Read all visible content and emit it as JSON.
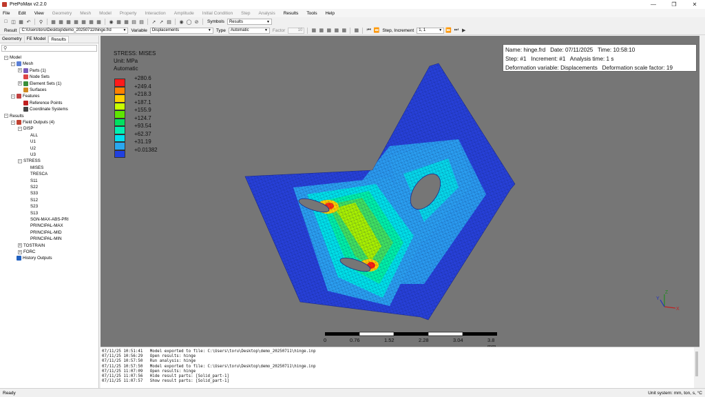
{
  "window": {
    "title": "PrePoMax v2.2.0"
  },
  "menu": {
    "items": [
      "File",
      "Edit",
      "View",
      "Geometry",
      "Mesh",
      "Model",
      "Property",
      "Interaction",
      "Amplitude",
      "Initial Condition",
      "Step",
      "Analysis",
      "Results",
      "Tools",
      "Help"
    ]
  },
  "toolbar": {
    "symbols_label": "Symbols",
    "symbols_value": "Results"
  },
  "results_bar": {
    "result_label": "Result",
    "result_file": "C:\\Users\\toru\\Desktop\\demo_20250711\\hinge.frd",
    "variable_label": "Variable",
    "variable_value": "Displacements",
    "type_label": "Type",
    "type_value": "Automatic",
    "factor_label": "Factor",
    "factor_value": "10",
    "step_label": "Step, Increment",
    "step_value": "1, 1"
  },
  "left_panel": {
    "tabs": [
      "Geometry",
      "FE Model",
      "Results"
    ],
    "active_tab": "Results",
    "tree": [
      {
        "label": "Model",
        "level": 0,
        "expander": "-",
        "icon": "none"
      },
      {
        "label": "Mesh",
        "level": 1,
        "expander": "-",
        "icon": "mesh"
      },
      {
        "label": "Parts (1)",
        "level": 2,
        "expander": "+",
        "icon": "parts"
      },
      {
        "label": "Node Sets",
        "level": 2,
        "expander": "",
        "icon": "nodes"
      },
      {
        "label": "Element Sets (1)",
        "level": 2,
        "expander": "+",
        "icon": "elements"
      },
      {
        "label": "Surfaces",
        "level": 2,
        "expander": "",
        "icon": "surfaces"
      },
      {
        "label": "Features",
        "level": 1,
        "expander": "-",
        "icon": "features"
      },
      {
        "label": "Reference Points",
        "level": 2,
        "expander": "",
        "icon": "refpoint"
      },
      {
        "label": "Coordinate Systems",
        "level": 2,
        "expander": "",
        "icon": "coords"
      },
      {
        "label": "Results",
        "level": 0,
        "expander": "-",
        "icon": "none"
      },
      {
        "label": "Field Outputs (4)",
        "level": 1,
        "expander": "-",
        "icon": "field"
      },
      {
        "label": "DISP",
        "level": 2,
        "expander": "-",
        "icon": "none"
      },
      {
        "label": "ALL",
        "level": 3,
        "expander": "",
        "icon": "none"
      },
      {
        "label": "U1",
        "level": 3,
        "expander": "",
        "icon": "none"
      },
      {
        "label": "U2",
        "level": 3,
        "expander": "",
        "icon": "none"
      },
      {
        "label": "U3",
        "level": 3,
        "expander": "",
        "icon": "none"
      },
      {
        "label": "STRESS",
        "level": 2,
        "expander": "-",
        "icon": "none"
      },
      {
        "label": "MISES",
        "level": 3,
        "expander": "",
        "icon": "none"
      },
      {
        "label": "TRESCA",
        "level": 3,
        "expander": "",
        "icon": "none"
      },
      {
        "label": "S11",
        "level": 3,
        "expander": "",
        "icon": "none"
      },
      {
        "label": "S22",
        "level": 3,
        "expander": "",
        "icon": "none"
      },
      {
        "label": "S33",
        "level": 3,
        "expander": "",
        "icon": "none"
      },
      {
        "label": "S12",
        "level": 3,
        "expander": "",
        "icon": "none"
      },
      {
        "label": "S23",
        "level": 3,
        "expander": "",
        "icon": "none"
      },
      {
        "label": "S13",
        "level": 3,
        "expander": "",
        "icon": "none"
      },
      {
        "label": "SGN-MAX-ABS-PRI",
        "level": 3,
        "expander": "",
        "icon": "none"
      },
      {
        "label": "PRINCIPAL-MAX",
        "level": 3,
        "expander": "",
        "icon": "none"
      },
      {
        "label": "PRINCIPAL-MID",
        "level": 3,
        "expander": "",
        "icon": "none"
      },
      {
        "label": "PRINCIPAL-MIN",
        "level": 3,
        "expander": "",
        "icon": "none"
      },
      {
        "label": "TOSTRAIN",
        "level": 2,
        "expander": "+",
        "icon": "none"
      },
      {
        "label": "FORC",
        "level": 2,
        "expander": "+",
        "icon": "none"
      },
      {
        "label": "History Outputs",
        "level": 1,
        "expander": "",
        "icon": "history"
      }
    ]
  },
  "viewport": {
    "legend": {
      "title_lines": [
        "STRESS: MISES",
        "Unit: MPa",
        "Automatic"
      ],
      "entries": [
        {
          "value": "+280.6",
          "color": "#ff1a1a"
        },
        {
          "value": "+249.4",
          "color": "#ff8000"
        },
        {
          "value": "+218.3",
          "color": "#ffd000"
        },
        {
          "value": "+187.1",
          "color": "#c8ff00"
        },
        {
          "value": "+155.9",
          "color": "#5ee600"
        },
        {
          "value": "+124.7",
          "color": "#00e060"
        },
        {
          "value": "+93.54",
          "color": "#00f0b0"
        },
        {
          "value": "+62.37",
          "color": "#00e0f0"
        },
        {
          "value": "+31.19",
          "color": "#2aa8f0"
        },
        {
          "value": "+0.01382",
          "color": "#2040e0"
        }
      ]
    },
    "info": {
      "name": "Name: hinge.frd",
      "date": "Date: 07/11/2025",
      "time": "Time: 10:58:10",
      "step": "Step: #1",
      "increment": "Increment: #1",
      "analysis_time": "Analysis time: 1 s",
      "deformation_variable": "Deformation variable: Displacements",
      "deformation_scale": "Deformation scale factor: 19"
    },
    "scale_bar": {
      "labels": [
        "0",
        "0.76",
        "1.52",
        "2.28",
        "3.04",
        "3.8 mm"
      ]
    },
    "axes": {
      "x": "X",
      "y": "Y",
      "z": "Z"
    }
  },
  "console": {
    "lines": [
      "07/11/25 10:51:41   Model exported to file: C:\\Users\\toru\\Desktop\\demo_20250711\\hinge.inp",
      "07/11/25 10:56:29   Open results: hinge",
      "07/11/25 10:57:50   Run analysis: hinge",
      "07/11/25 10:57:50   Model exported to file: C:\\Users\\toru\\Desktop\\demo_20250711\\hinge.inp",
      "07/11/25 11:07:09   Open results: hinge",
      "07/11/25 11:07:56   Hide result parts: [Solid_part-1]",
      "07/11/25 11:07:57   Show result parts: [Solid_part-1]"
    ]
  },
  "status": {
    "left": "Ready",
    "right": "Unit system: mm, ton, s, °C"
  }
}
